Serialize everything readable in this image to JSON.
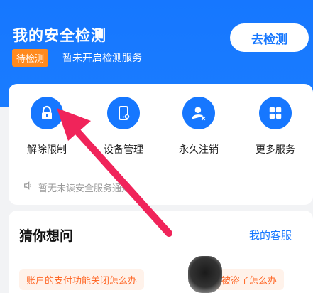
{
  "header": {
    "title": "我的安全检测",
    "status_badge": "待检测",
    "status_text": "暂未开启检测服务",
    "check_button": "去检测"
  },
  "services": [
    {
      "label": "解除限制",
      "icon": "lock-icon"
    },
    {
      "label": "设备管理",
      "icon": "phone-icon"
    },
    {
      "label": "永久注销",
      "icon": "user-cancel-icon"
    },
    {
      "label": "更多服务",
      "icon": "grid-icon"
    }
  ],
  "notice": {
    "text": "暂无未读安全服务通知",
    "icon": "speaker-icon"
  },
  "guess": {
    "title": "猜你想问",
    "my_service": "我的客服",
    "questions": [
      "账户的支付功能关闭怎么办",
      "被盗了怎么办"
    ]
  },
  "colors": {
    "primary": "#1677ff",
    "badge": "#ff8a1f",
    "arrow": "#f0245a",
    "question_bg": "#fff2ea",
    "question_text": "#ff6a2a"
  }
}
